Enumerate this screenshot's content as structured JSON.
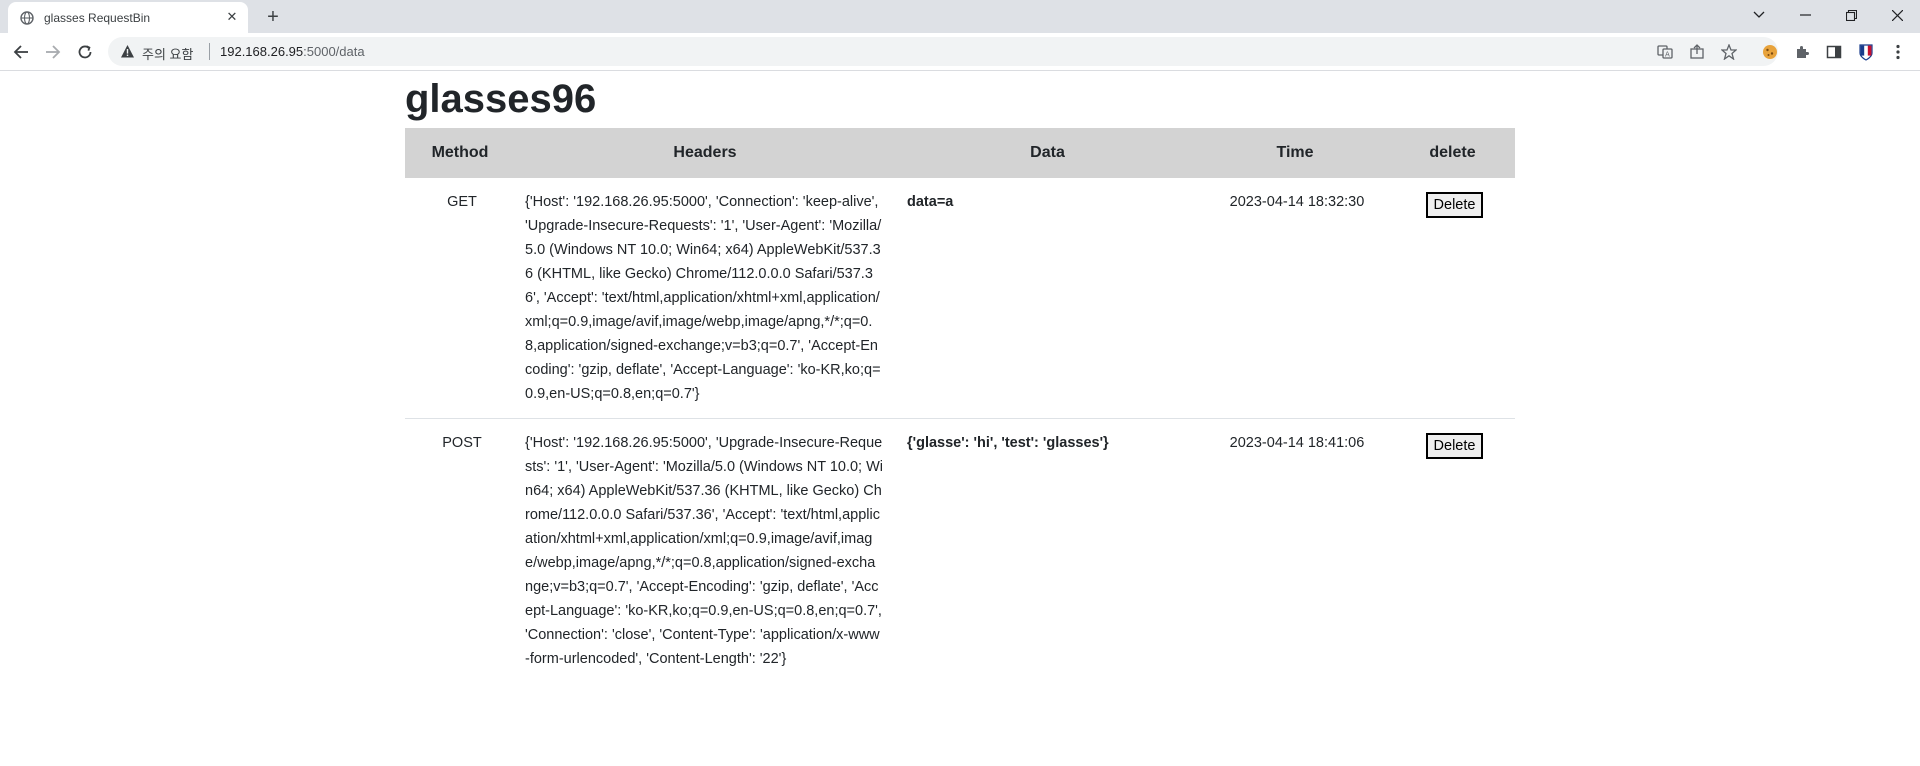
{
  "browser": {
    "tab_title": "glasses RequestBin",
    "tab_close": "✕",
    "new_tab": "+",
    "address_warning": "주의 요함",
    "url_host": "192.168.26.95",
    "url_rest": ":5000/data"
  },
  "page": {
    "title": "glasses96"
  },
  "table": {
    "columns": [
      "Method",
      "Headers",
      "Data",
      "Time",
      "delete"
    ],
    "rows": [
      {
        "method": "GET",
        "headers": "{'Host': '192.168.26.95:5000', 'Connection': 'keep-alive', 'Upgrade-Insecure-Requests': '1', 'User-Agent': 'Mozilla/5.0 (Windows NT 10.0; Win64; x64) AppleWebKit/537.36 (KHTML, like Gecko) Chrome/112.0.0.0 Safari/537.36', 'Accept': 'text/html,application/xhtml+xml,application/xml;q=0.9,image/avif,image/webp,image/apng,*/*;q=0.8,application/signed-exchange;v=b3;q=0.7', 'Accept-Encoding': 'gzip, deflate', 'Accept-Language': 'ko-KR,ko;q=0.9,en-US;q=0.8,en;q=0.7'}",
        "data": "data=a",
        "time": "2023-04-14 18:32:30",
        "delete_label": "Delete"
      },
      {
        "method": "POST",
        "headers": "{'Host': '192.168.26.95:5000', 'Upgrade-Insecure-Requests': '1', 'User-Agent': 'Mozilla/5.0 (Windows NT 10.0; Win64; x64) AppleWebKit/537.36 (KHTML, like Gecko) Chrome/112.0.0.0 Safari/537.36', 'Accept': 'text/html,application/xhtml+xml,application/xml;q=0.9,image/avif,image/webp,image/apng,*/*;q=0.8,application/signed-exchange;v=b3;q=0.7', 'Accept-Encoding': 'gzip, deflate', 'Accept-Language': 'ko-KR,ko;q=0.9,en-US;q=0.8,en;q=0.7', 'Connection': 'close', 'Content-Type': 'application/x-www-form-urlencoded', 'Content-Length': '22'}",
        "data": "{'glasse': 'hi', 'test': 'glasses'}",
        "time": "2023-04-14 18:41:06",
        "delete_label": "Delete"
      }
    ]
  }
}
